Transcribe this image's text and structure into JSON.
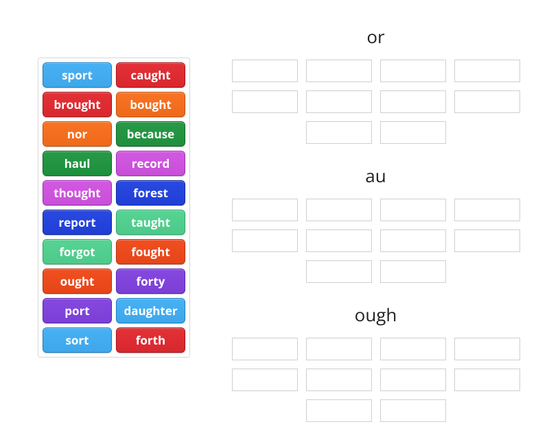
{
  "wordBank": [
    {
      "label": "sport",
      "color": "#3ea7ea",
      "border": "#1d7fbf"
    },
    {
      "label": "caught",
      "color": "#d9272e",
      "border": "#a31217"
    },
    {
      "label": "brought",
      "color": "#d9272e",
      "border": "#a31217"
    },
    {
      "label": "bought",
      "color": "#ee6a1a",
      "border": "#c44f0a"
    },
    {
      "label": "nor",
      "color": "#ee6a1a",
      "border": "#c44f0a"
    },
    {
      "label": "because",
      "color": "#1e8f3d",
      "border": "#116528"
    },
    {
      "label": "haul",
      "color": "#1e8f3d",
      "border": "#116528"
    },
    {
      "label": "record",
      "color": "#c84fd8",
      "border": "#9a2fae"
    },
    {
      "label": "thought",
      "color": "#c84fd8",
      "border": "#9a2fae"
    },
    {
      "label": "forest",
      "color": "#1f3fd6",
      "border": "#112a9e"
    },
    {
      "label": "report",
      "color": "#1f3fd6",
      "border": "#112a9e"
    },
    {
      "label": "taught",
      "color": "#4dc98a",
      "border": "#2da767"
    },
    {
      "label": "forgot",
      "color": "#4dc98a",
      "border": "#2da767"
    },
    {
      "label": "fought",
      "color": "#e64518",
      "border": "#b8330d"
    },
    {
      "label": "ought",
      "color": "#e64518",
      "border": "#b8330d"
    },
    {
      "label": "forty",
      "color": "#7b3fd6",
      "border": "#5a24ad"
    },
    {
      "label": "port",
      "color": "#7b3fd6",
      "border": "#5a24ad"
    },
    {
      "label": "daughter",
      "color": "#3ea7ea",
      "border": "#1d7fbf"
    },
    {
      "label": "sort",
      "color": "#3ea7ea",
      "border": "#1d7fbf"
    },
    {
      "label": "forth",
      "color": "#d9272e",
      "border": "#a31217"
    }
  ],
  "categories": [
    {
      "title": "or",
      "slots": 10
    },
    {
      "title": "au",
      "slots": 10
    },
    {
      "title": "ough",
      "slots": 10
    }
  ]
}
